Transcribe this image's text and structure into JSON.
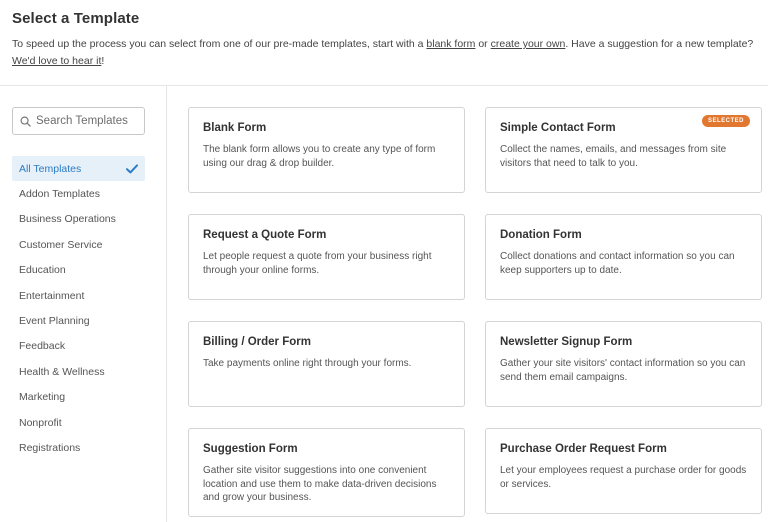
{
  "header": {
    "title": "Select a Template",
    "intro_prefix": "To speed up the process you can select from one of our pre-made templates, start with a",
    "blank_form_link": "blank form",
    "intro_or": "or",
    "create_link": "create your own",
    "intro_middle": ". Have a suggestion for a new template?",
    "love_link": "We'd love to hear it",
    "intro_suffix": "!"
  },
  "search": {
    "placeholder": "Search Templates",
    "value": ""
  },
  "categories": [
    {
      "label": "All Templates",
      "active": true
    },
    {
      "label": "Addon Templates"
    },
    {
      "label": "Business Operations"
    },
    {
      "label": "Customer Service"
    },
    {
      "label": "Education"
    },
    {
      "label": "Entertainment"
    },
    {
      "label": "Event Planning"
    },
    {
      "label": "Feedback"
    },
    {
      "label": "Health & Wellness"
    },
    {
      "label": "Marketing"
    },
    {
      "label": "Nonprofit"
    },
    {
      "label": "Registrations"
    }
  ],
  "templates": [
    {
      "title": "Blank Form",
      "description": "The blank form allows you to create any type of form using our drag & drop builder."
    },
    {
      "title": "Simple Contact Form",
      "description": "Collect the names, emails, and messages from site visitors that need to talk to you.",
      "badge": "SELECTED"
    },
    {
      "title": "Request a Quote Form",
      "description": "Let people request a quote from your business right through your online forms."
    },
    {
      "title": "Donation Form",
      "description": "Collect donations and contact information so you can keep supporters up to date."
    },
    {
      "title": "Billing / Order Form",
      "description": "Take payments online right through your forms."
    },
    {
      "title": "Newsletter Signup Form",
      "description": "Gather your site visitors' contact information so you can send them email campaigns."
    },
    {
      "title": "Suggestion Form",
      "description": "Gather site visitor suggestions into one convenient location and use them to make data-driven decisions and grow your business."
    },
    {
      "title": "Purchase Order Request Form",
      "description": "Let your employees request a purchase order for goods or services."
    }
  ],
  "colors": {
    "accent": "#2d7bc2",
    "active_bg": "#e6f0f9",
    "badge": "#e27730"
  },
  "icons": {
    "search": "search-icon",
    "check": "checkmark-icon"
  }
}
